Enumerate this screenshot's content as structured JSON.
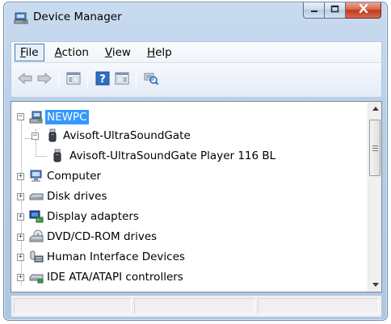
{
  "window": {
    "title": "Device Manager",
    "icon": "device-manager-icon"
  },
  "menu": {
    "items": [
      {
        "label_u": "F",
        "label_rest": "ile"
      },
      {
        "label_u": "A",
        "label_rest": "ction"
      },
      {
        "label_u": "V",
        "label_rest": "iew"
      },
      {
        "label_u": "H",
        "label_rest": "elp"
      }
    ]
  },
  "toolbar": {
    "buttons": [
      "back-arrow-icon",
      "forward-arrow-icon",
      "show-hide-console-tree-icon",
      "help-icon",
      "properties-pane-icon",
      "scan-hardware-icon"
    ]
  },
  "tree": {
    "root": "NEWPC",
    "items": [
      {
        "label": "Avisoft-UltraSoundGate",
        "icon": "usb-device-icon",
        "expander": "−"
      },
      {
        "label": "Avisoft-UltraSoundGate Player 116 BL",
        "icon": "usb-device-icon",
        "expander": ""
      },
      {
        "label": "Computer",
        "icon": "computer-icon",
        "expander": "+"
      },
      {
        "label": "Disk drives",
        "icon": "disk-drive-icon",
        "expander": "+"
      },
      {
        "label": "Display adapters",
        "icon": "display-adapter-icon",
        "expander": "+"
      },
      {
        "label": "DVD/CD-ROM drives",
        "icon": "dvd-drive-icon",
        "expander": "+"
      },
      {
        "label": "Human Interface Devices",
        "icon": "hid-icon",
        "expander": "+"
      },
      {
        "label": "IDE ATA/ATAPI controllers",
        "icon": "ide-controller-icon",
        "expander": "+"
      }
    ],
    "root_expander": "−"
  },
  "colors": {
    "selection": "#3399ff",
    "close_button": "#c0391f",
    "frame": "#b7cde8"
  }
}
